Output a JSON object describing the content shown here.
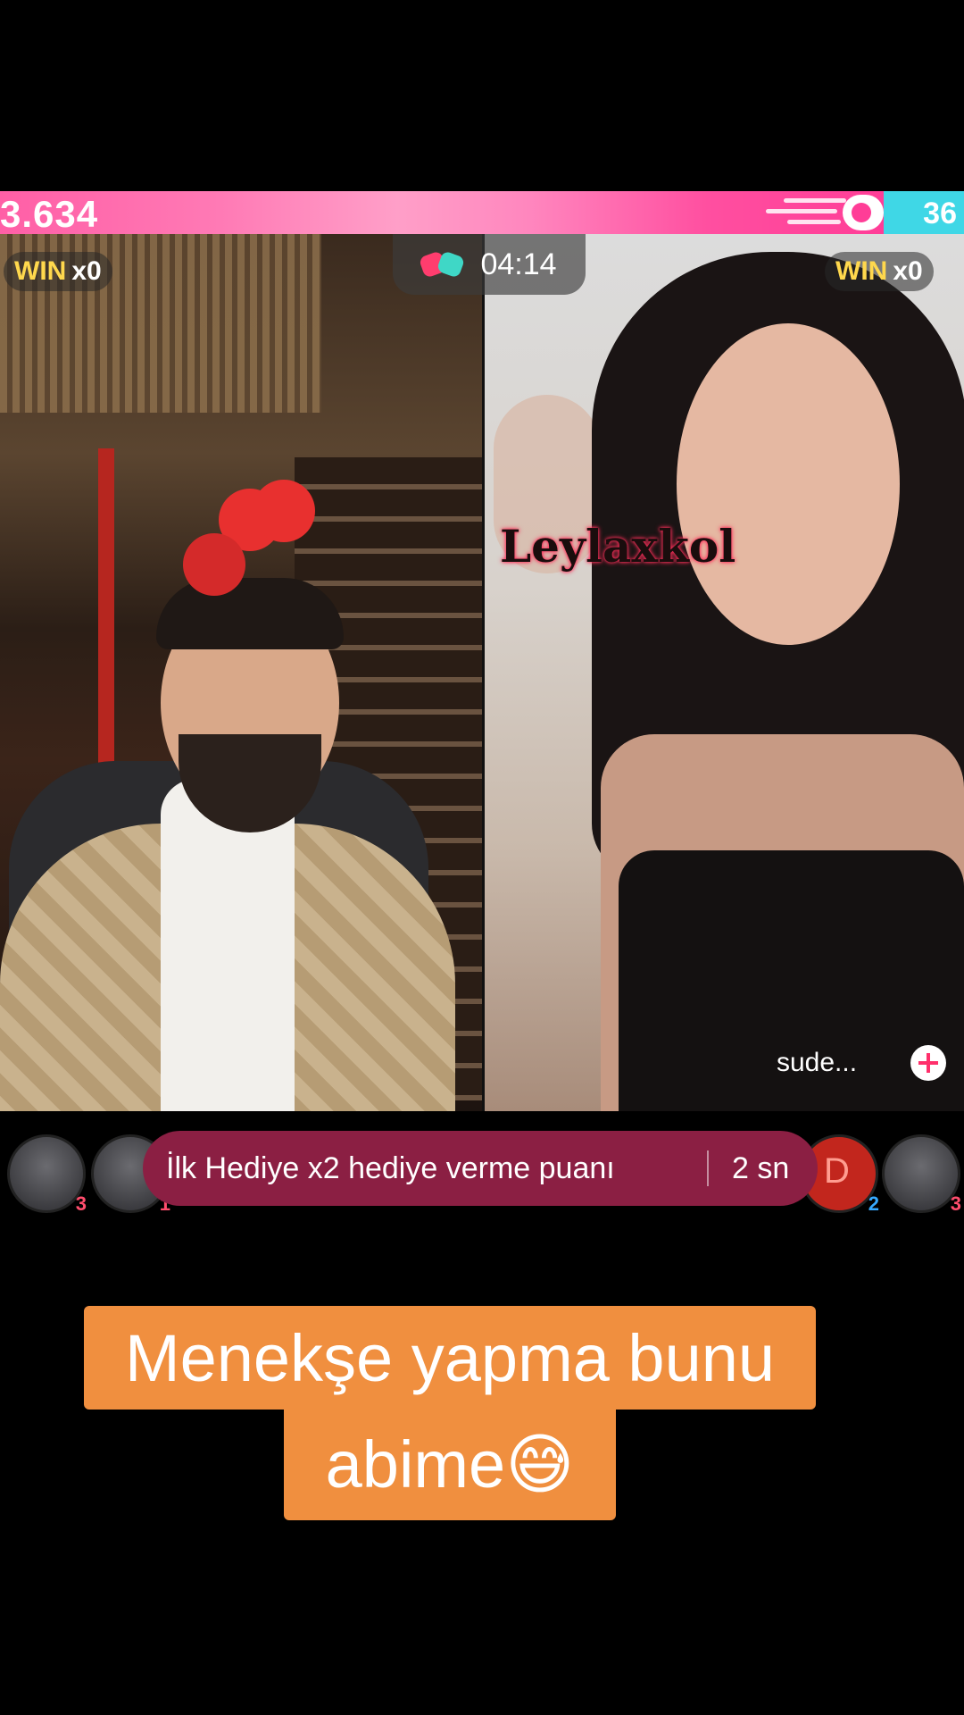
{
  "battle": {
    "left_score": "3.634",
    "right_score": "36",
    "timer": "04:14",
    "left_win": {
      "label": "WIN",
      "count": "x0"
    },
    "right_win": {
      "label": "WIN",
      "count": "x0"
    }
  },
  "right_stream": {
    "overlay_name": "Leylaxkol",
    "host_name": "sude..."
  },
  "supporters": {
    "left": [
      {
        "rank": "3"
      },
      {
        "rank": "1"
      }
    ],
    "right": [
      {
        "letter": "D",
        "rank": "2"
      },
      {
        "rank": "3"
      }
    ]
  },
  "promo_banner": {
    "text": "İlk Hediye x2 hediye verme puanı",
    "time": "2 sn"
  },
  "caption": {
    "line1": "Menekşe yapma bunu",
    "line2": "abime😅"
  },
  "colors": {
    "left_bar": "#ff5fa6",
    "right_bar": "#3fd7e6",
    "banner": "#8b1f43",
    "caption_bg": "#f08f3f",
    "win_label": "#ffd84d"
  },
  "icons": [
    "boost-icon",
    "boxing-gloves-icon",
    "follow-plus-icon"
  ]
}
